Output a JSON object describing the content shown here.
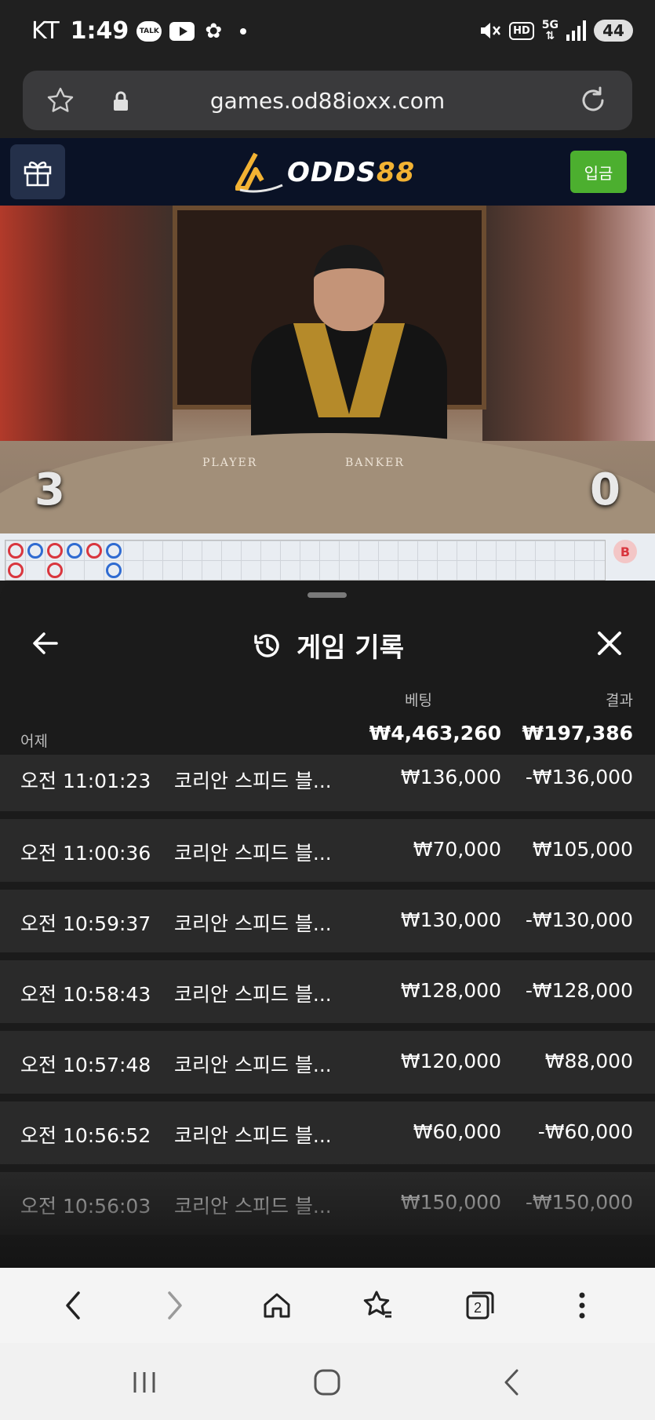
{
  "status_bar": {
    "carrier": "KT",
    "time": "1:49",
    "talk_label": "TALK",
    "network": "5G",
    "hd_label": "HD",
    "battery": "44"
  },
  "browser": {
    "url": "games.od88ioxx.com"
  },
  "site_header": {
    "logo_main": "ODDS",
    "logo_accent": "88",
    "deposit_label": "입금"
  },
  "video": {
    "player_score": "3",
    "banker_score": "0",
    "player_text": "PLAYER",
    "banker_text": "BANKER"
  },
  "roadmap": {
    "badge": "B"
  },
  "sheet": {
    "title": "게임 기록",
    "col_bet": "베팅",
    "col_result": "결과",
    "group_label": "어제",
    "total_bet": "₩4,463,260",
    "total_result": "₩197,386",
    "rows": [
      {
        "time": "오전 11:01:23",
        "game": "코리안 스피드 블...",
        "bet": "₩136,000",
        "result": "-₩136,000"
      },
      {
        "time": "오전 11:00:36",
        "game": "코리안 스피드 블...",
        "bet": "₩70,000",
        "result": "₩105,000"
      },
      {
        "time": "오전 10:59:37",
        "game": "코리안 스피드 블...",
        "bet": "₩130,000",
        "result": "-₩130,000"
      },
      {
        "time": "오전 10:58:43",
        "game": "코리안 스피드 블...",
        "bet": "₩128,000",
        "result": "-₩128,000"
      },
      {
        "time": "오전 10:57:48",
        "game": "코리안 스피드 블...",
        "bet": "₩120,000",
        "result": "₩88,000"
      },
      {
        "time": "오전 10:56:52",
        "game": "코리안 스피드 블...",
        "bet": "₩60,000",
        "result": "-₩60,000"
      },
      {
        "time": "오전 10:56:03",
        "game": "코리안 스피드 블...",
        "bet": "₩150,000",
        "result": "-₩150,000"
      }
    ]
  },
  "toolbar": {
    "tab_count": "2"
  },
  "colors": {
    "sheet_bg": "#1b1b1b",
    "row_bg": "#2a2a2a",
    "deposit_green": "#4caf2f",
    "logo_gold": "#f2b233",
    "header_navy": "#0a1226"
  }
}
